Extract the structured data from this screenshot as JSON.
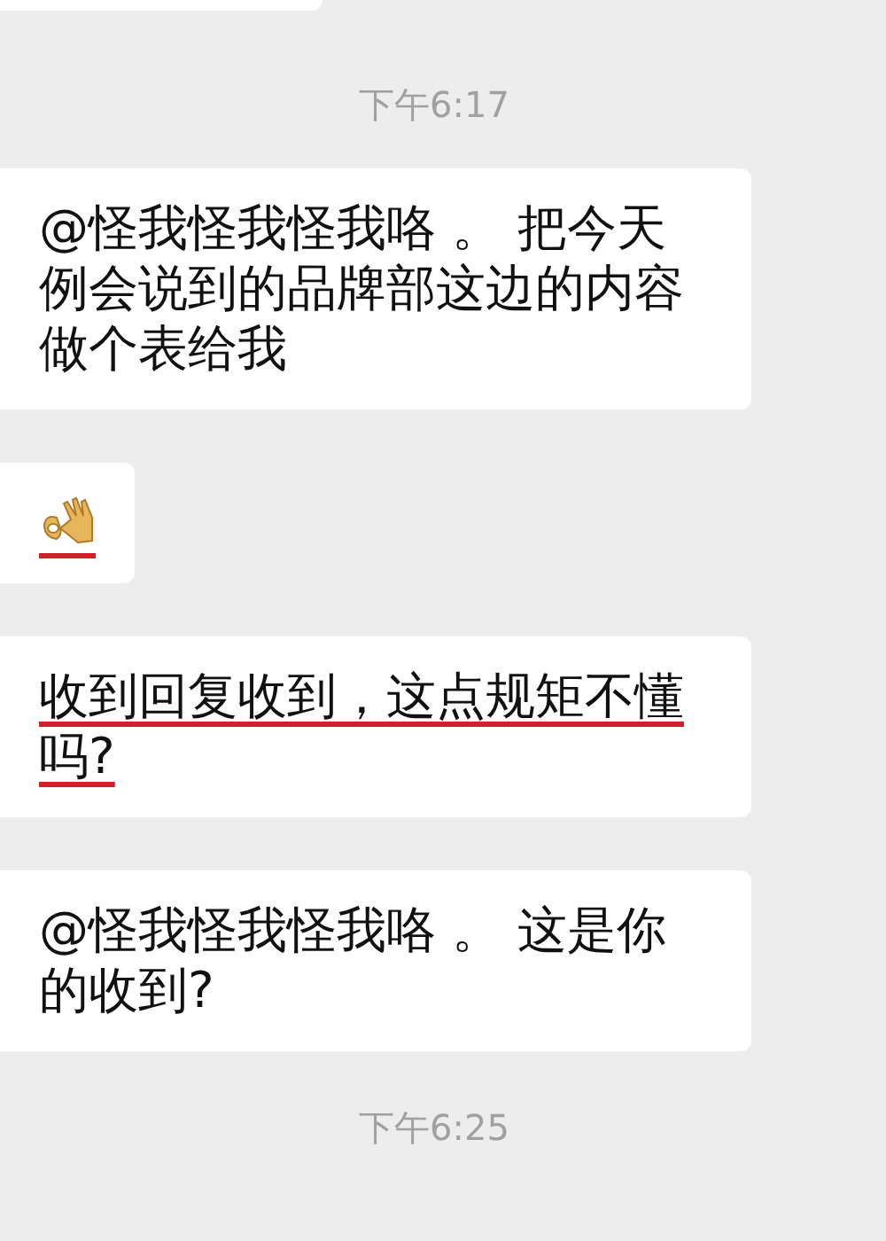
{
  "items": [
    {
      "kind": "partial"
    },
    {
      "kind": "time",
      "text": "下午6:17"
    },
    {
      "kind": "text",
      "text": "@怪我怪我怪我咯 。 把今天例会说到的品牌部这边的内容做个表给我",
      "underlined": false
    },
    {
      "kind": "emoji",
      "underlined": true
    },
    {
      "kind": "text",
      "text": "收到回复收到，这点规矩不懂吗?",
      "underlined": true
    },
    {
      "kind": "text",
      "text": "@怪我怪我怪我咯 。 这是你的收到?",
      "underlined": false
    },
    {
      "kind": "time",
      "text": "下午6:25"
    }
  ]
}
